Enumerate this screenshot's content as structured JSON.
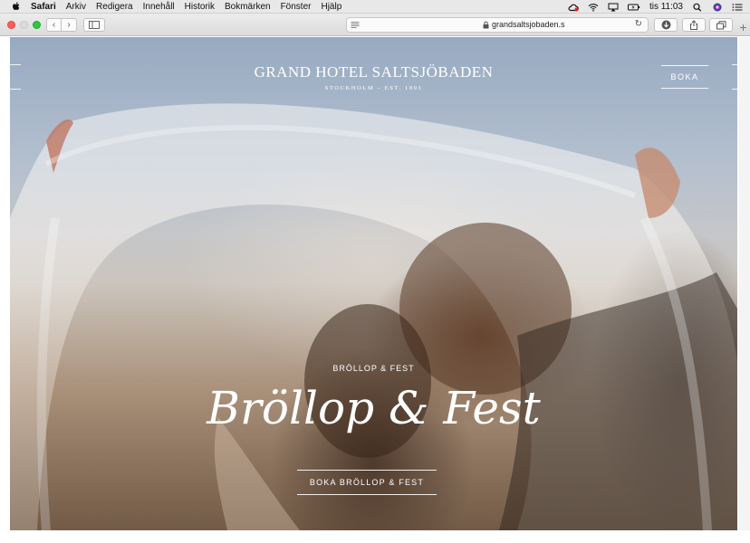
{
  "menubar": {
    "items": [
      "Safari",
      "Arkiv",
      "Redigera",
      "Innehåll",
      "Historik",
      "Bokmärken",
      "Fönster",
      "Hjälp"
    ],
    "clock": "tis 11:03"
  },
  "toolbar": {
    "url": "grandsaltsjobaden.s",
    "back_glyph": "‹",
    "forward_glyph": "›",
    "reload_glyph": "↻",
    "new_tab_glyph": "+"
  },
  "hero": {
    "brand_name": "GRAND HOTEL SALTSJÖBADEN",
    "brand_tagline": "STOCKHOLM – EST. 1893",
    "book_button": "BOKA",
    "eyebrow": "BRÖLLOP & FEST",
    "headline": "Bröllop & Fest",
    "cta_button": "BOKA BRÖLLOP & FEST"
  },
  "colors": {
    "close": "#fc5f57",
    "zoom": "#2bc840",
    "hero_text": "#ffffff"
  },
  "icons": [
    "apple-icon",
    "creative-cloud-icon",
    "wifi-icon",
    "airplay-icon",
    "battery-icon",
    "search-icon",
    "siri-icon",
    "list-icon",
    "reader-icon",
    "lock-icon",
    "download-icon",
    "share-icon",
    "tabs-icon",
    "sidebar-icon"
  ]
}
